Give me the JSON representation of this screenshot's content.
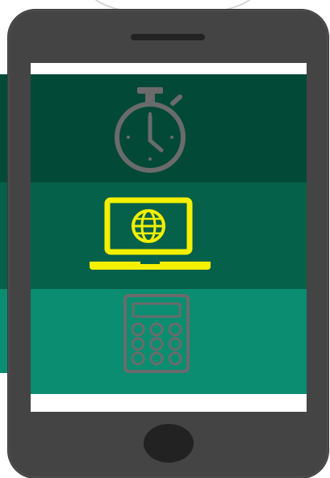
{
  "colors": {
    "band_dark": "#034937",
    "band_mid": "#06614a",
    "band_light": "#0a8d71",
    "icon_default": "#6b6b6b",
    "icon_highlight": "#f4f000",
    "phone_body": "#444444",
    "phone_detail": "#222222",
    "screen_bg": "#ffffff"
  },
  "screen": {
    "bands": [
      {
        "name": "timer-band",
        "icon": "stopwatch-icon",
        "color": "#034937",
        "selected": false
      },
      {
        "name": "online-band",
        "icon": "laptop-globe-icon",
        "color": "#06614a",
        "selected": true
      },
      {
        "name": "calculator-band",
        "icon": "calculator-icon",
        "color": "#0a8d71",
        "selected": false
      }
    ]
  }
}
